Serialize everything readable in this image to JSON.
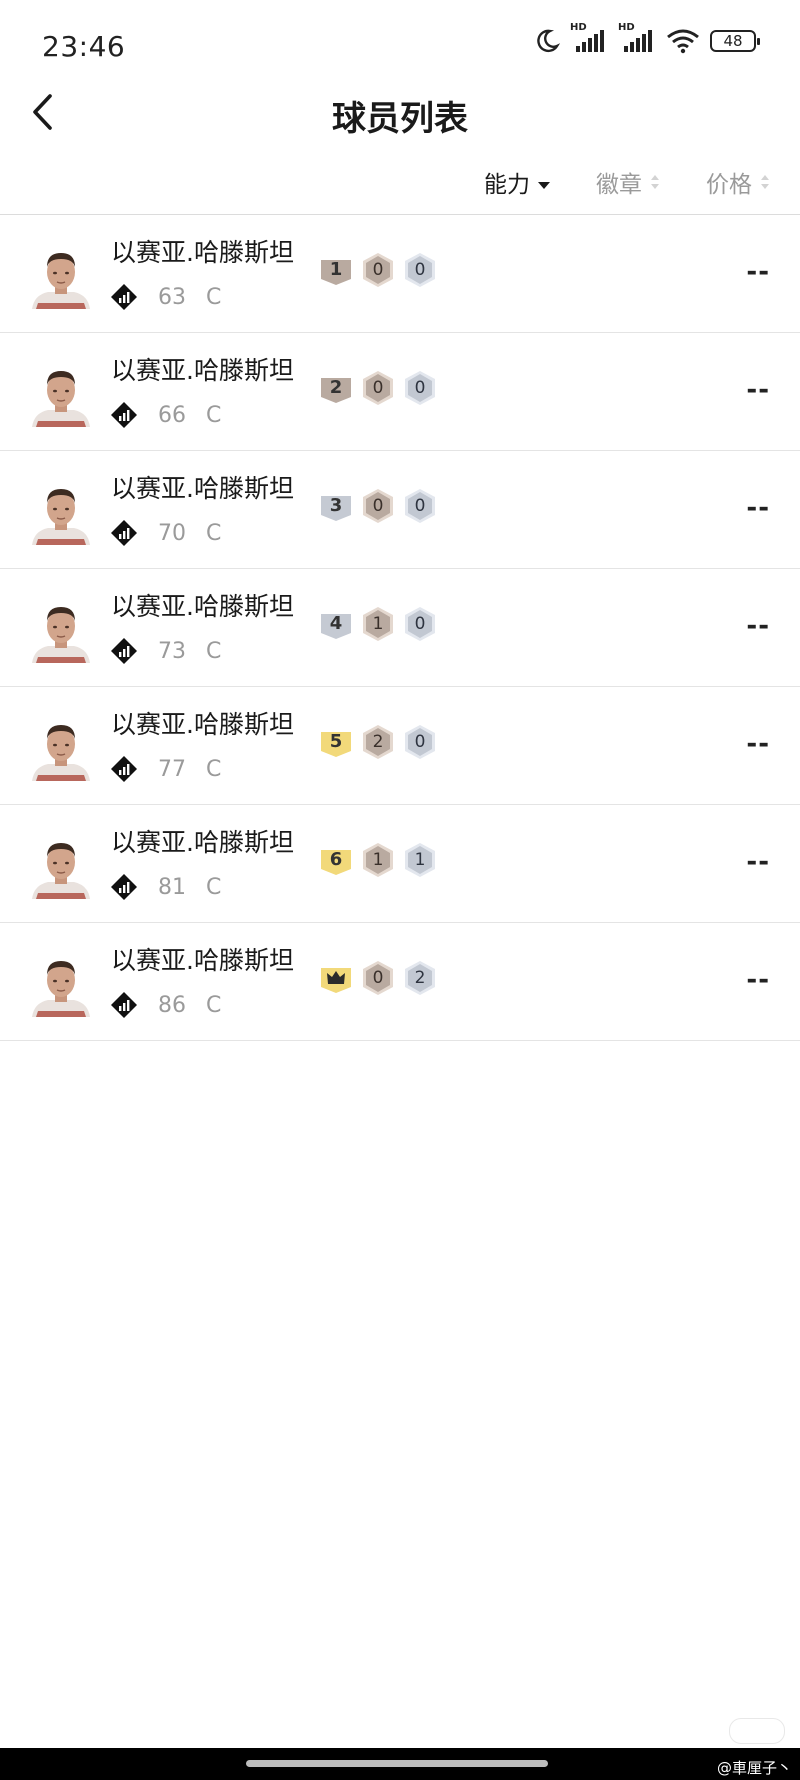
{
  "status": {
    "time": "23:46",
    "battery": "48",
    "signal_label_1": "HD",
    "signal_label_2": "HD"
  },
  "header": {
    "title": "球员列表"
  },
  "sort": {
    "options": [
      {
        "label": "能力",
        "state": "active-desc"
      },
      {
        "label": "徽章",
        "state": "inactive"
      },
      {
        "label": "价格",
        "state": "inactive"
      }
    ]
  },
  "players": [
    {
      "name": "以赛亚.哈滕斯坦",
      "rating": "63",
      "position": "C",
      "level": "1",
      "level_color": "#b9aaa0",
      "badge_a": "0",
      "badge_b": "0",
      "price": "--"
    },
    {
      "name": "以赛亚.哈滕斯坦",
      "rating": "66",
      "position": "C",
      "level": "2",
      "level_color": "#b9aaa0",
      "badge_a": "0",
      "badge_b": "0",
      "price": "--"
    },
    {
      "name": "以赛亚.哈滕斯坦",
      "rating": "70",
      "position": "C",
      "level": "3",
      "level_color": "#c5cad3",
      "badge_a": "0",
      "badge_b": "0",
      "price": "--"
    },
    {
      "name": "以赛亚.哈滕斯坦",
      "rating": "73",
      "position": "C",
      "level": "4",
      "level_color": "#c5cad3",
      "badge_a": "1",
      "badge_b": "0",
      "price": "--"
    },
    {
      "name": "以赛亚.哈滕斯坦",
      "rating": "77",
      "position": "C",
      "level": "5",
      "level_color": "#f2d97a",
      "badge_a": "2",
      "badge_b": "0",
      "price": "--"
    },
    {
      "name": "以赛亚.哈滕斯坦",
      "rating": "81",
      "position": "C",
      "level": "6",
      "level_color": "#f2d97a",
      "badge_a": "1",
      "badge_b": "1",
      "price": "--"
    },
    {
      "name": "以赛亚.哈滕斯坦",
      "rating": "86",
      "position": "C",
      "level": "",
      "level_icon": "crown-icon",
      "level_color": "#f2d97a",
      "badge_a": "0",
      "badge_b": "2",
      "price": "--"
    }
  ],
  "watermark": "@車厘子丶"
}
